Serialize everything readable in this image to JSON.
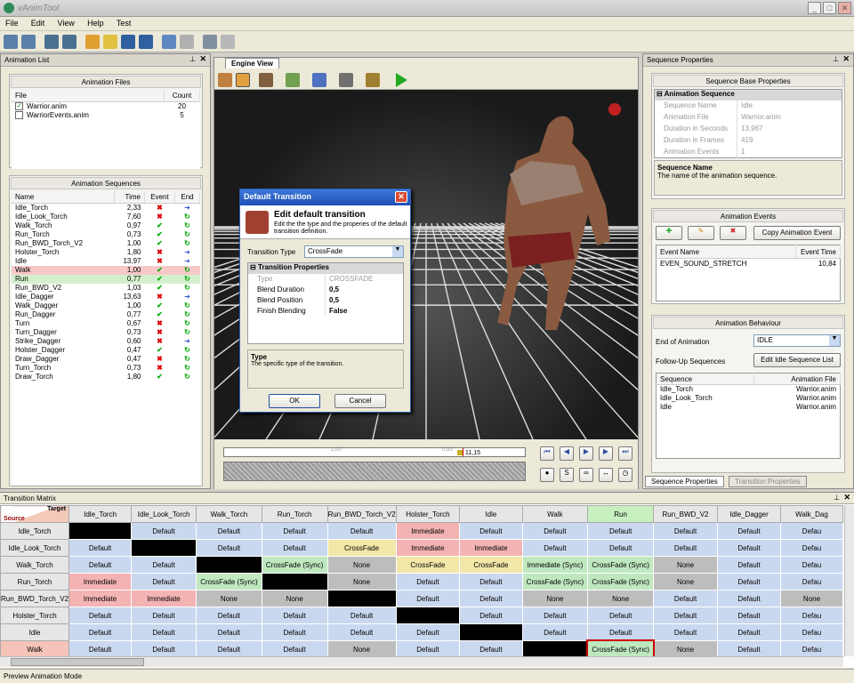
{
  "app": {
    "title": "vAnimTool"
  },
  "menu": [
    "File",
    "Edit",
    "View",
    "Help",
    "Test"
  ],
  "anim_list": {
    "title": "Animation List",
    "files_group": "Animation Files",
    "files_cols": [
      "File",
      "Count"
    ],
    "files": [
      {
        "name": "Warrior.anim",
        "count": "20",
        "checked": true
      },
      {
        "name": "WarriorEvents.anim",
        "count": "5",
        "checked": false
      }
    ],
    "seq_group": "Animation Sequences",
    "seq_cols": [
      "Name",
      "Time",
      "Event",
      "End"
    ],
    "sequences": [
      {
        "name": "Idle_Torch",
        "time": "2,33",
        "event": "x",
        "end": "arrow"
      },
      {
        "name": "Idle_Look_Torch",
        "time": "7,60",
        "event": "x",
        "end": "loop"
      },
      {
        "name": "Walk_Torch",
        "time": "0,97",
        "event": "check",
        "end": "loop"
      },
      {
        "name": "Run_Torch",
        "time": "0,73",
        "event": "check",
        "end": "loop"
      },
      {
        "name": "Run_BWD_Torch_V2",
        "time": "1,00",
        "event": "check",
        "end": "loop"
      },
      {
        "name": "Holster_Torch",
        "time": "1,80",
        "event": "x",
        "end": "arrow"
      },
      {
        "name": "Idle",
        "time": "13,97",
        "event": "x",
        "end": "arrow"
      },
      {
        "name": "Walk",
        "time": "1,00",
        "event": "check",
        "end": "loop"
      },
      {
        "name": "Run",
        "time": "0,77",
        "event": "check",
        "end": "loop"
      },
      {
        "name": "Run_BWD_V2",
        "time": "1,03",
        "event": "check",
        "end": "loop"
      },
      {
        "name": "Idle_Dagger",
        "time": "13,63",
        "event": "x",
        "end": "arrow"
      },
      {
        "name": "Walk_Dagger",
        "time": "1,00",
        "event": "check",
        "end": "loop"
      },
      {
        "name": "Run_Dagger",
        "time": "0,77",
        "event": "check",
        "end": "loop"
      },
      {
        "name": "Turn",
        "time": "0,67",
        "event": "x",
        "end": "loop"
      },
      {
        "name": "Turn_Dagger",
        "time": "0,73",
        "event": "x",
        "end": "loop"
      },
      {
        "name": "Strike_Dagger",
        "time": "0,60",
        "event": "x",
        "end": "arrow"
      },
      {
        "name": "Holster_Dagger",
        "time": "0,47",
        "event": "check",
        "end": "loop"
      },
      {
        "name": "Draw_Dagger",
        "time": "0,47",
        "event": "x",
        "end": "loop"
      },
      {
        "name": "Turn_Torch",
        "time": "0,73",
        "event": "x",
        "end": "loop"
      },
      {
        "name": "Draw_Torch",
        "time": "1,80",
        "event": "check",
        "end": "loop"
      }
    ]
  },
  "engine": {
    "tab": "Engine View",
    "timeline": {
      "mid_label": "1,00",
      "pos_label": "0,93",
      "end_label": "11,15"
    },
    "dialog": {
      "title": "Default Transition",
      "heading": "Edit default transition",
      "desc": "Edit the the type and the properies of the default transition definition.",
      "type_label": "Transition Type",
      "type_value": "CrossFade",
      "props_title": "Transition Properties",
      "props": [
        {
          "k": "Type",
          "v": "CROSSFADE",
          "disabled": true
        },
        {
          "k": "Blend Duration",
          "v": "0,5",
          "disabled": false
        },
        {
          "k": "Blend Position",
          "v": "0,5",
          "disabled": false
        },
        {
          "k": "Finish Blending",
          "v": "False",
          "disabled": false
        }
      ],
      "help_title": "Type",
      "help_text": "The specific type of the transition.",
      "ok": "OK",
      "cancel": "Cancel"
    }
  },
  "seq_props": {
    "title": "Sequence Properties",
    "base_group": "Sequence Base Properties",
    "section": "Animation Sequence",
    "rows": [
      {
        "k": "Sequence Name",
        "v": "Idle"
      },
      {
        "k": "Animation File",
        "v": "Warrior.anim"
      },
      {
        "k": "Duration in Seconds",
        "v": "13,967"
      },
      {
        "k": "Duration in Frames",
        "v": "419"
      },
      {
        "k": "Animation Events",
        "v": "1"
      }
    ],
    "help_title": "Sequence Name",
    "help_text": "The name of the animation sequence.",
    "events_group": "Animation Events",
    "copy_event": "Copy Animation Event",
    "events_cols": [
      "Event Name",
      "Event Time"
    ],
    "events": [
      {
        "name": "EVEN_SOUND_STRETCH",
        "time": "10,84"
      }
    ],
    "behaviour_group": "Animation Behaviour",
    "end_label": "End of Animation",
    "end_value": "IDLE",
    "followup_label": "Follow-Up Sequences",
    "followup_btn": "Edit Idle Sequence List",
    "followup_cols": [
      "Sequence",
      "Animation File"
    ],
    "followups": [
      {
        "seq": "Idle_Torch",
        "file": "Warrior.anim"
      },
      {
        "seq": "Idle_Look_Torch",
        "file": "Warrior.anim"
      },
      {
        "seq": "Idle",
        "file": "Warrior.anim"
      }
    ],
    "tabs": [
      "Sequence Properties",
      "Transition Properties"
    ]
  },
  "matrix": {
    "title": "Transition Matrix",
    "corner_target": "Target",
    "corner_source": "Source",
    "cols": [
      "Idle_Torch",
      "Idle_Look_Torch",
      "Walk_Torch",
      "Run_Torch",
      "Run_BWD_Torch_V2",
      "Holster_Torch",
      "Idle",
      "Walk",
      "Run",
      "Run_BWD_V2",
      "Idle_Dagger",
      "Walk_Dag"
    ],
    "rows": [
      {
        "name": "Idle_Torch",
        "cells": [
          "",
          "Default",
          "Default",
          "Default",
          "Default",
          "Immediate",
          "Default",
          "Default",
          "Default",
          "Default",
          "Default",
          "Defau"
        ]
      },
      {
        "name": "Idle_Look_Torch",
        "cells": [
          "Default",
          "",
          "Default",
          "Default",
          "CrossFade",
          "Immediate",
          "Immediate",
          "Default",
          "Default",
          "Default",
          "Default",
          "Defau"
        ]
      },
      {
        "name": "Walk_Torch",
        "cells": [
          "Default",
          "Default",
          "",
          "CrossFade (Sync)",
          "None",
          "CrossFade",
          "CrossFade",
          "Immediate (Sync)",
          "CrossFade (Sync)",
          "None",
          "Default",
          "Defau"
        ]
      },
      {
        "name": "Run_Torch",
        "cells": [
          "Immediate",
          "Default",
          "CrossFade (Sync)",
          "",
          "None",
          "Default",
          "Default",
          "CrossFade (Sync)",
          "CrossFade (Sync)",
          "None",
          "Default",
          "Defau"
        ]
      },
      {
        "name": "Run_BWD_Torch_V2",
        "cells": [
          "Immediate",
          "Immediate",
          "None",
          "None",
          "",
          "Default",
          "Default",
          "None",
          "None",
          "Default",
          "Default",
          "None"
        ]
      },
      {
        "name": "Holster_Torch",
        "cells": [
          "Default",
          "Default",
          "Default",
          "Default",
          "Default",
          "",
          "Default",
          "Default",
          "Default",
          "Default",
          "Default",
          "Defau"
        ]
      },
      {
        "name": "Idle",
        "cells": [
          "Default",
          "Default",
          "Default",
          "Default",
          "Default",
          "Default",
          "",
          "Default",
          "Default",
          "Default",
          "Default",
          "Defau"
        ]
      },
      {
        "name": "Walk",
        "cells": [
          "Default",
          "Default",
          "Default",
          "Default",
          "None",
          "Default",
          "Default",
          "",
          "CrossFade (Sync)",
          "None",
          "Default",
          "Defau"
        ]
      }
    ]
  },
  "status": "Preview Animation Mode",
  "colors": {
    "default": "#c9d8ef",
    "immediate": "#f4b3b3",
    "crossfade": "#f3e7a8",
    "sync": "#bfe8bf",
    "none": "#bdbdbd",
    "diag": "#000000",
    "walk_row": "#f6c3b8",
    "run_col": "#c8efc0"
  }
}
